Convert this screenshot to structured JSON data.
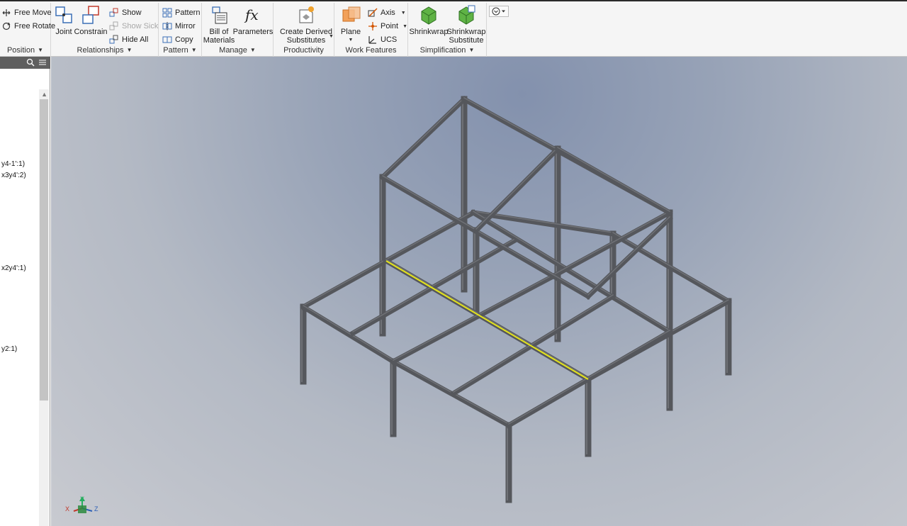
{
  "ribbon": {
    "position": {
      "free_move": "Free Move",
      "free_rotate": "Free Rotate",
      "title": "Position"
    },
    "relationships": {
      "joint": "Joint",
      "constrain": "Constrain",
      "show": "Show",
      "show_sick": "Show Sick",
      "hide_all": "Hide All",
      "title": "Relationships"
    },
    "pattern": {
      "pattern": "Pattern",
      "mirror": "Mirror",
      "copy": "Copy",
      "title": "Pattern"
    },
    "manage": {
      "bill_of_materials": "Bill of\nMaterials",
      "parameters": "Parameters",
      "title": "Manage"
    },
    "productivity": {
      "create_derived_substitutes": "Create Derived\nSubstitutes",
      "title": "Productivity"
    },
    "work_features": {
      "plane": "Plane",
      "axis": "Axis",
      "point": "Point",
      "ucs": "UCS",
      "title": "Work Features"
    },
    "simplification": {
      "shrinkwrap": "Shrinkwrap",
      "shrinkwrap_substitute": "Shrinkwrap\nSubstitute",
      "title": "Simplification"
    }
  },
  "browser": {
    "items": [
      "y4-1':1)",
      "x3y4':2)",
      "x2y4':1)",
      "y2:1)"
    ]
  },
  "viewcube": {
    "x": "X",
    "y": "Y",
    "z": "Z"
  },
  "colors": {
    "steel": "#55575c",
    "steel_light": "#6f7176",
    "selection": "#e6e619"
  }
}
